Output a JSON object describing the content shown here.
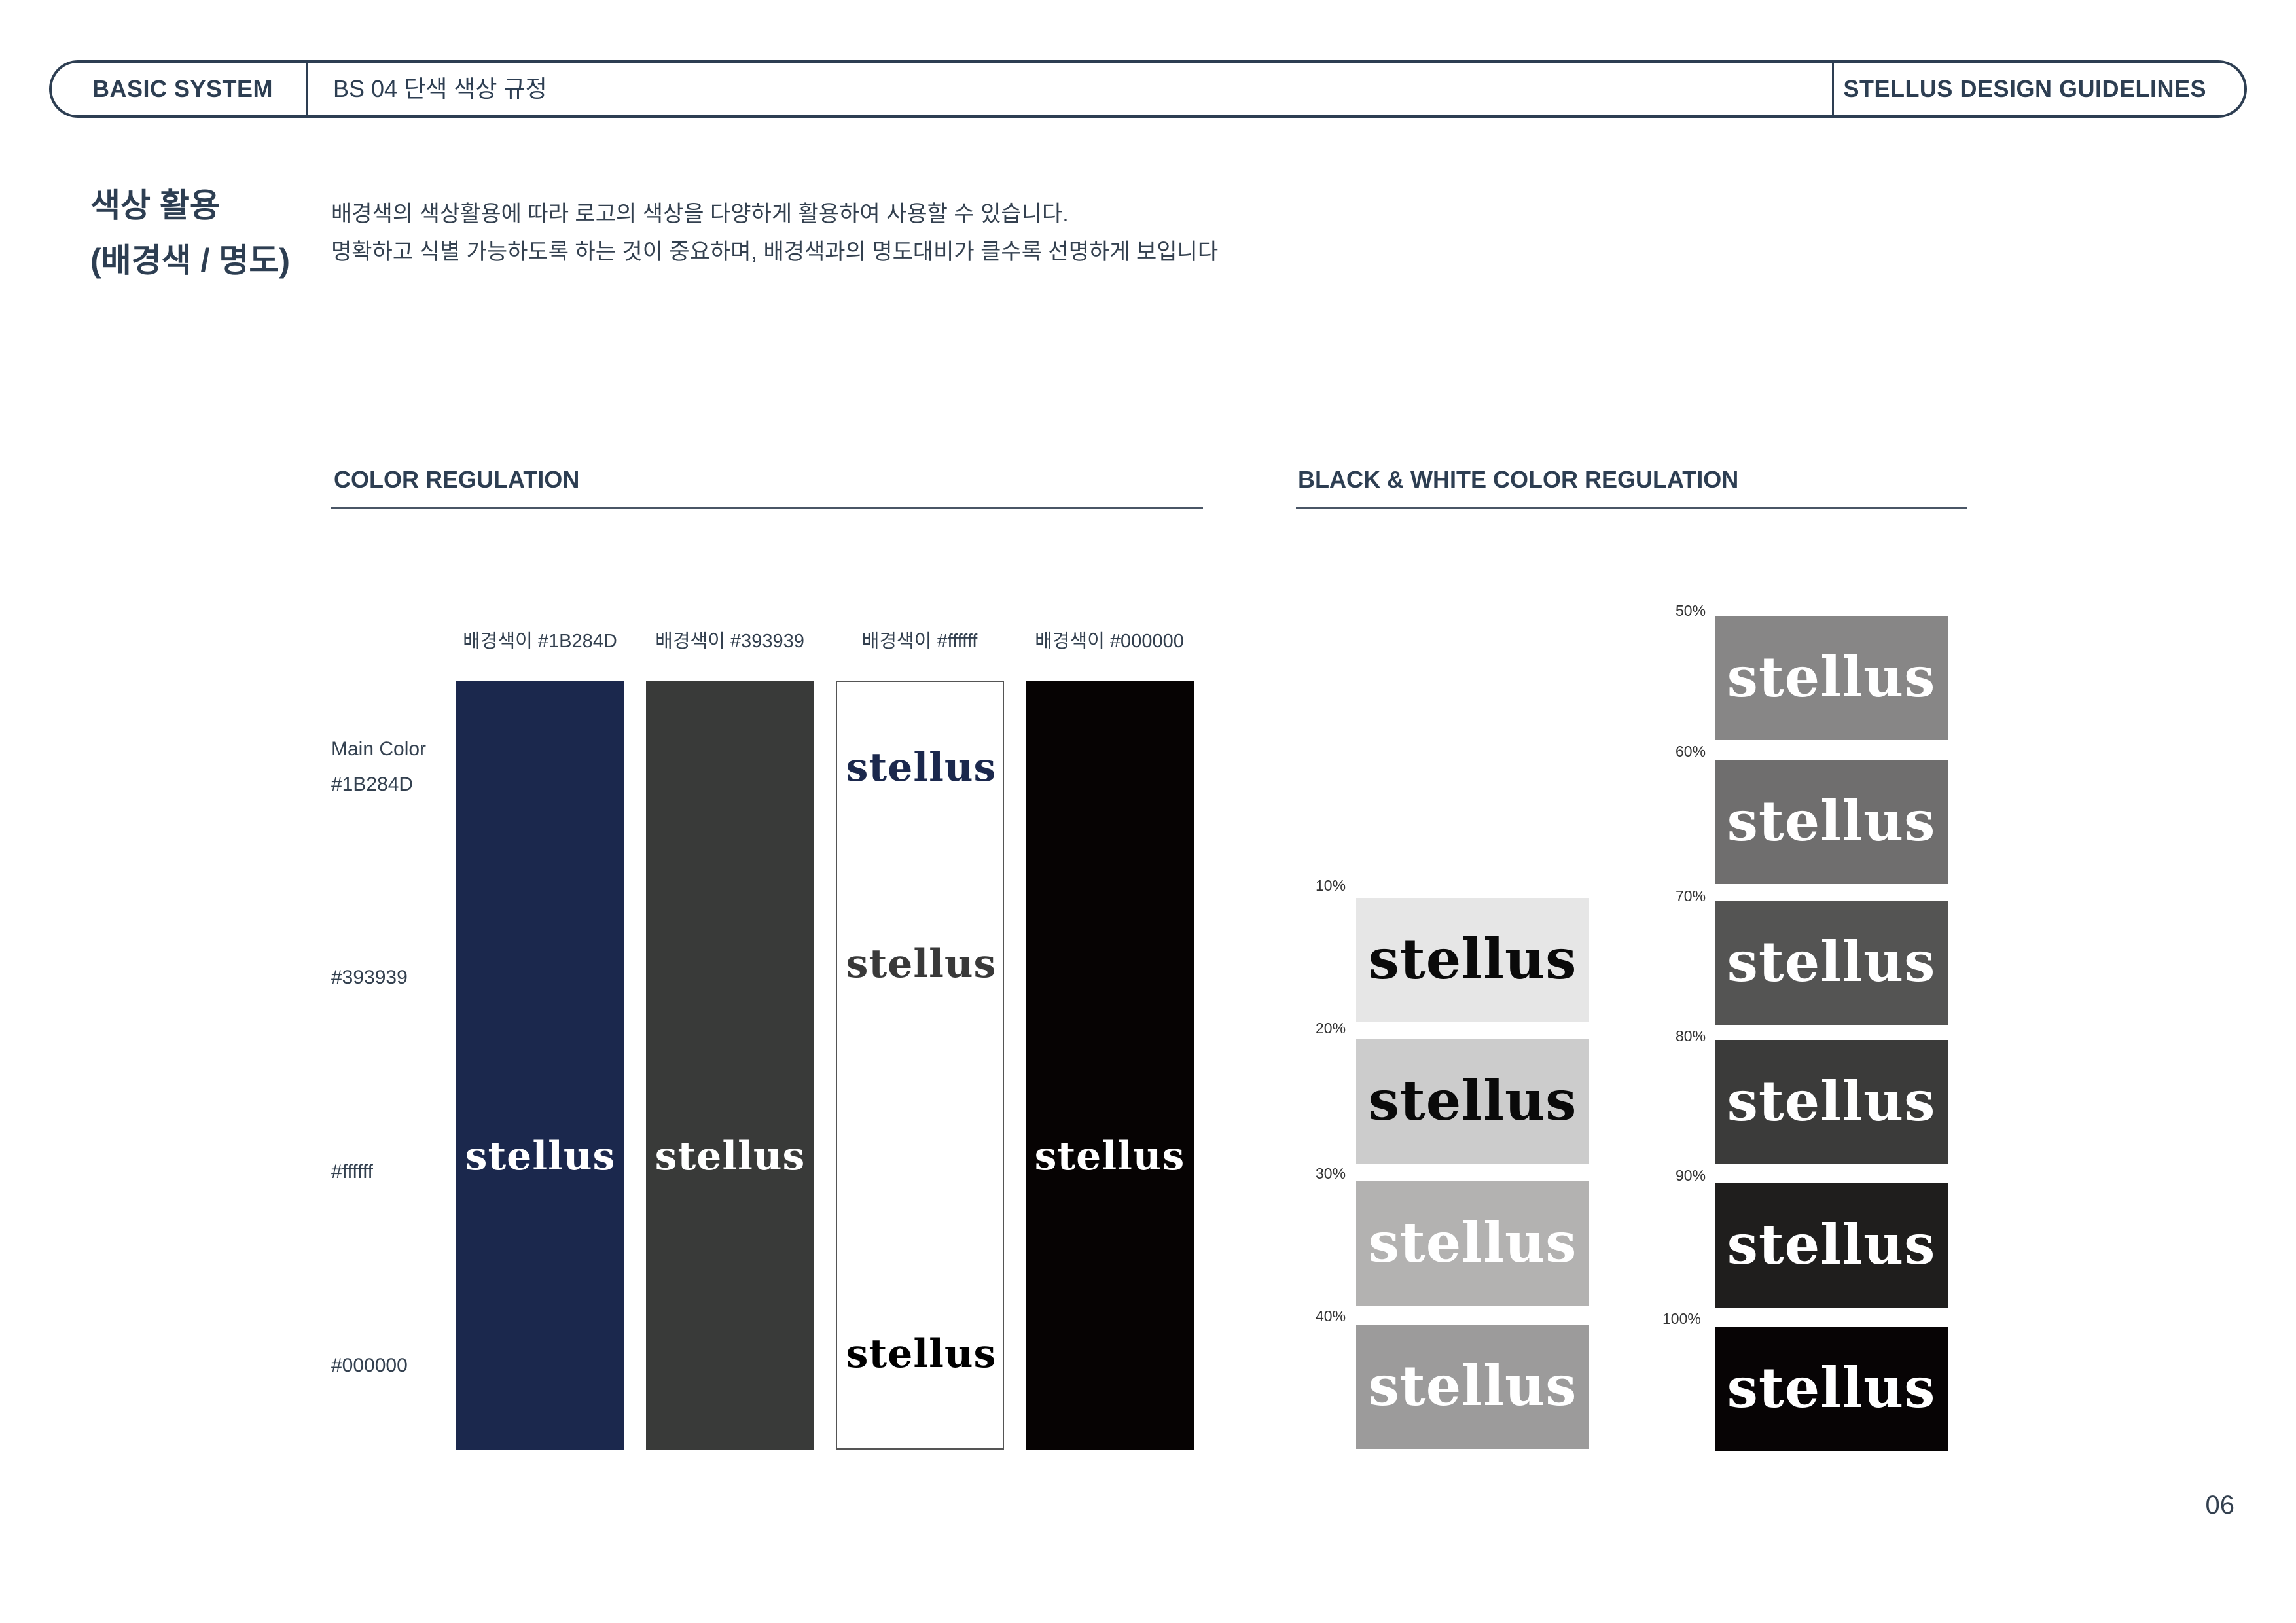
{
  "header": {
    "left": "BASIC SYSTEM",
    "middle": "BS 04  단색 색상 규정",
    "right": "STELLUS DESIGN GUIDELINES"
  },
  "section": {
    "title_line1": "색상 활용",
    "title_line2": "(배경색 / 명도)",
    "desc_line1": "배경색의 색상활용에 따라 로고의 색상을 다양하게 활용하여 사용할 수 있습니다.",
    "desc_line2": "명확하고 식별 가능하도록 하는 것이 중요하며, 배경색과의 명도대비가 클수록 선명하게 보입니다"
  },
  "color_regulation": {
    "title": "COLOR REGULATION",
    "columns": [
      {
        "label": "배경색이 #1B284D",
        "bg": "#1b284d"
      },
      {
        "label": "배경색이 #393939",
        "bg": "#393a39"
      },
      {
        "label": "배경색이 #ffffff",
        "bg": "#ffffff"
      },
      {
        "label": "배경색이 #000000",
        "bg": "#060303"
      }
    ],
    "rows": [
      {
        "label_line1": "Main Color",
        "label_line2": "#1B284D",
        "logo_color": "#1b284d"
      },
      {
        "label_line1": "#393939",
        "label_line2": "",
        "logo_color": "#393939"
      },
      {
        "label_line1": "#ffffff",
        "label_line2": "",
        "logo_color": "#ffffff"
      },
      {
        "label_line1": "#000000",
        "label_line2": "",
        "logo_color": "#000000"
      }
    ],
    "logo_text": "stellus"
  },
  "bw_regulation": {
    "title": "BLACK & WHITE COLOR REGULATION",
    "tiles": [
      {
        "pct": "10%",
        "bg": "#e6e6e6",
        "logo_color": "#0a0a0a"
      },
      {
        "pct": "20%",
        "bg": "#cccccc",
        "logo_color": "#0a0a0a"
      },
      {
        "pct": "30%",
        "bg": "#b3b2b1",
        "logo_color": "#ffffff"
      },
      {
        "pct": "40%",
        "bg": "#9c9b9b",
        "logo_color": "#ffffff"
      },
      {
        "pct": "50%",
        "bg": "#878686",
        "logo_color": "#ffffff"
      },
      {
        "pct": "60%",
        "bg": "#6f6e6e",
        "logo_color": "#ffffff"
      },
      {
        "pct": "70%",
        "bg": "#545453",
        "logo_color": "#ffffff"
      },
      {
        "pct": "80%",
        "bg": "#3b3b3a",
        "logo_color": "#ffffff"
      },
      {
        "pct": "90%",
        "bg": "#1f1e1d",
        "logo_color": "#ffffff"
      },
      {
        "pct": "100%",
        "bg": "#070405",
        "logo_color": "#ffffff"
      }
    ],
    "logo_text": "stellus"
  },
  "page_number": "06"
}
